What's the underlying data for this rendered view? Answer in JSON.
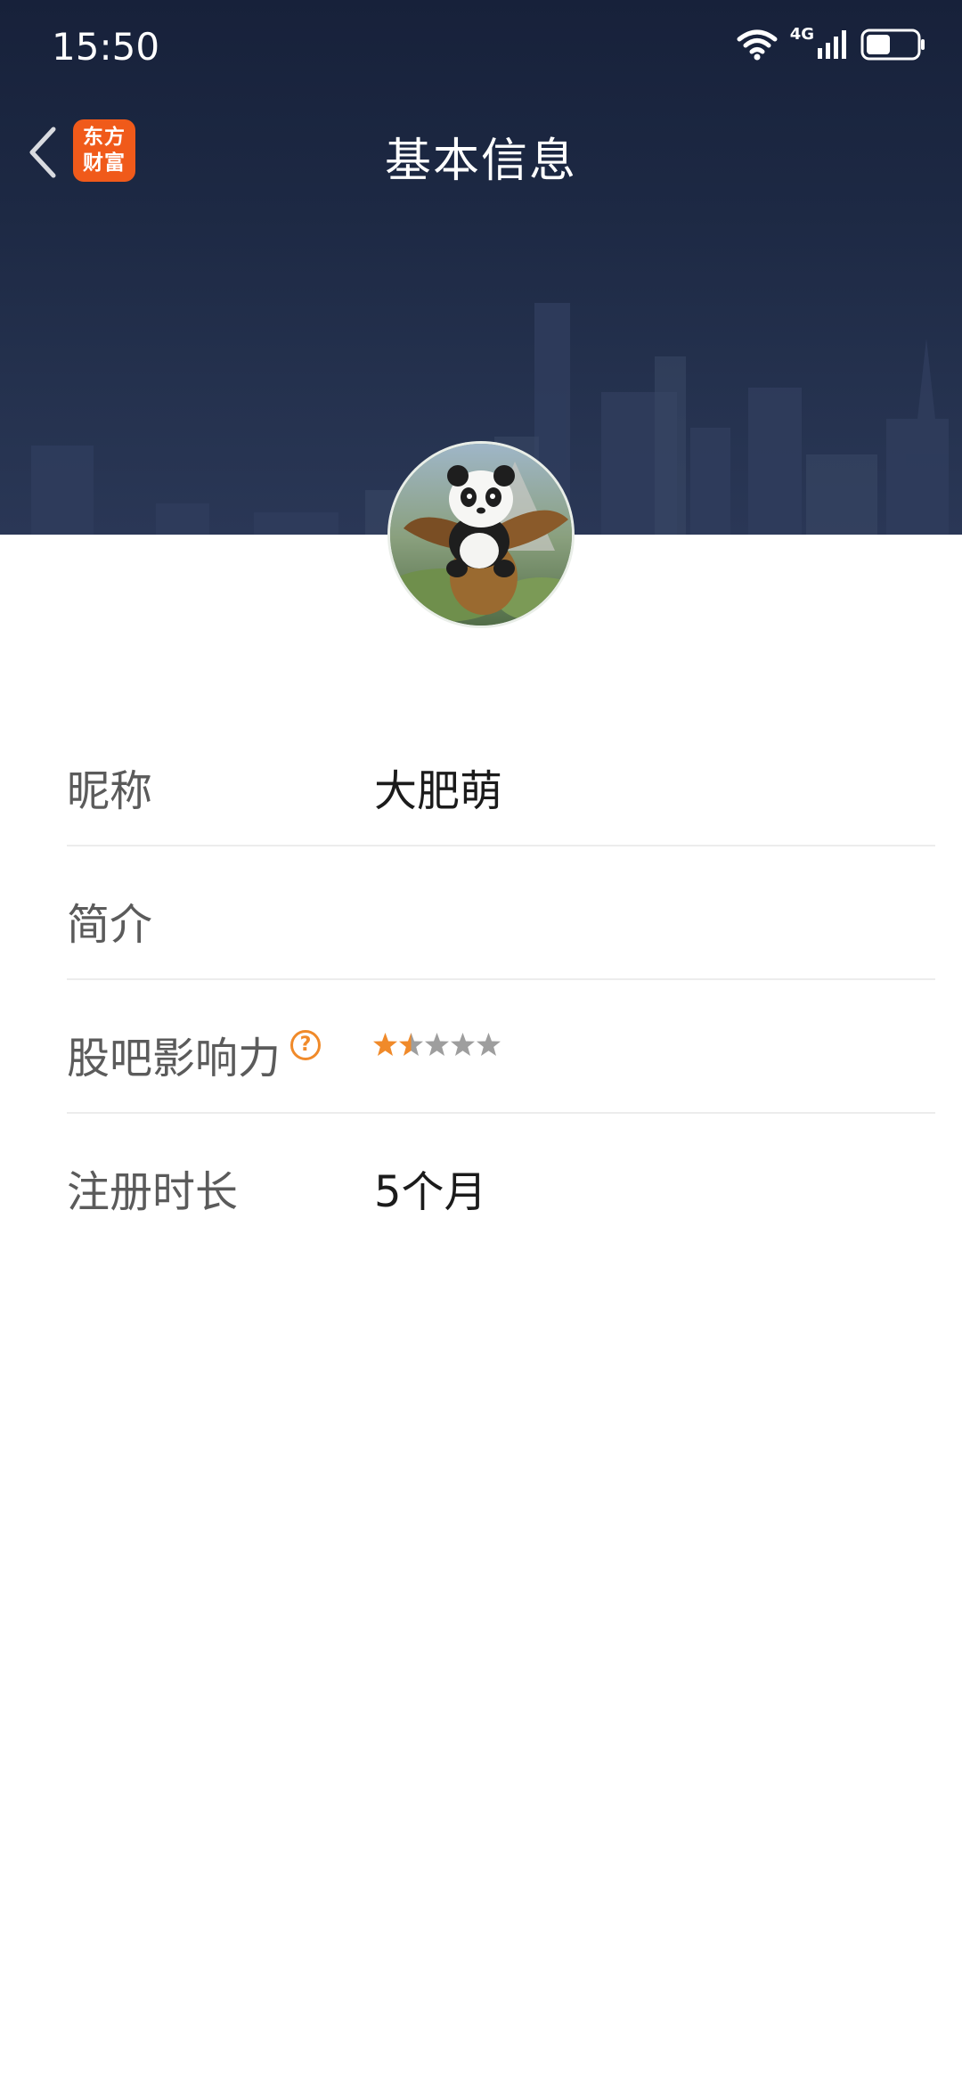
{
  "status_bar": {
    "time": "15:50",
    "network": "4G"
  },
  "nav": {
    "title": "基本信息",
    "app_logo_text_line1": "东方",
    "app_logo_text_line2": "财富"
  },
  "profile": {
    "fields": [
      {
        "label": "昵称",
        "value": "大肥萌"
      },
      {
        "label": "简介",
        "value": ""
      },
      {
        "label": "股吧影响力",
        "value": "",
        "rating": 1.5,
        "rating_max": 5
      },
      {
        "label": "注册时长",
        "value": "5个月"
      }
    ]
  },
  "colors": {
    "accent": "#f08a2a",
    "logo": "#f05a1a",
    "header_bg": "#1d2944"
  }
}
